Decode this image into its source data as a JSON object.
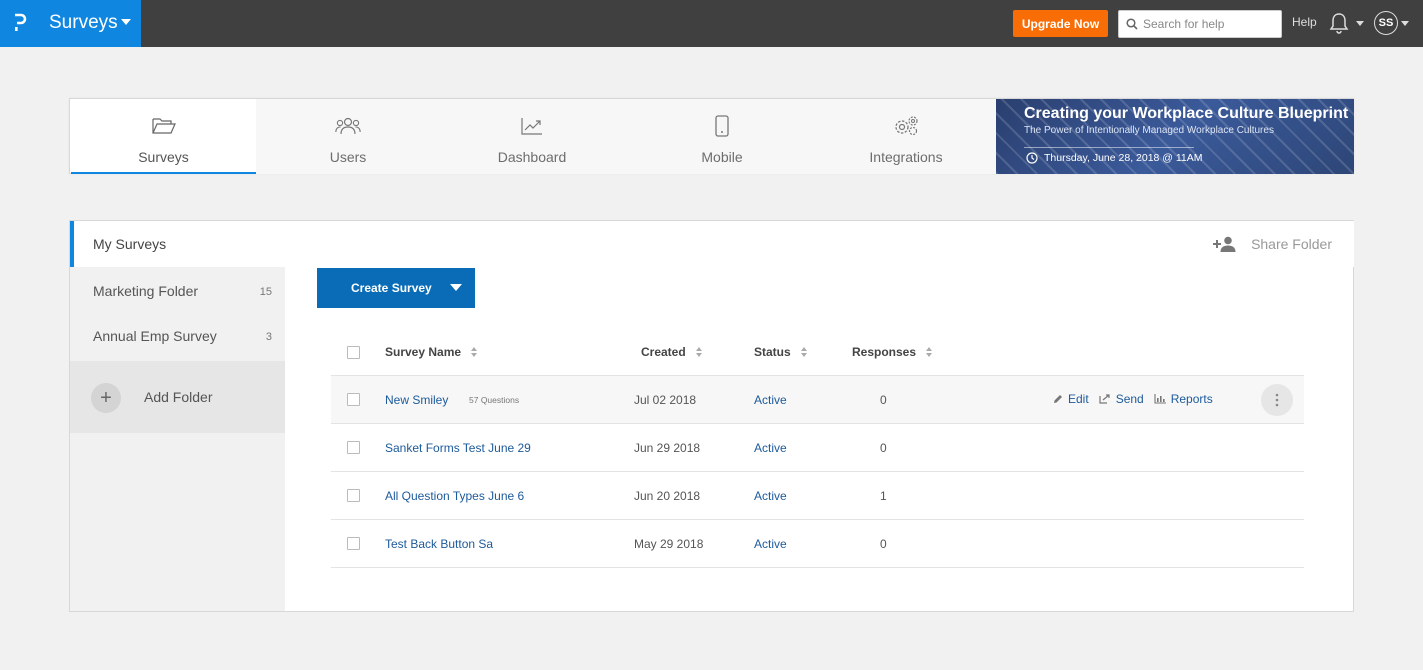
{
  "topbar": {
    "app_name": "Surveys",
    "upgrade_label": "Upgrade Now",
    "search_placeholder": "Search for help",
    "help_label": "Help",
    "avatar_initials": "SS"
  },
  "nav": {
    "tabs": [
      {
        "label": "Surveys",
        "icon": "folder-open-icon",
        "active": true
      },
      {
        "label": "Users",
        "icon": "users-icon",
        "active": false
      },
      {
        "label": "Dashboard",
        "icon": "chart-line-icon",
        "active": false
      },
      {
        "label": "Mobile",
        "icon": "mobile-icon",
        "active": false
      },
      {
        "label": "Integrations",
        "icon": "gears-icon",
        "active": false
      }
    ],
    "banner": {
      "title": "Creating your Workplace Culture Blueprint",
      "subtitle": "The Power of Intentionally Managed Workplace Cultures",
      "date": "Thursday, June 28, 2018 @ 11AM"
    }
  },
  "sidebar": {
    "header": "My Surveys",
    "folders": [
      {
        "name": "Marketing Folder",
        "count": "15"
      },
      {
        "name": "Annual Emp Survey",
        "count": "3"
      }
    ],
    "add_folder_label": "Add Folder"
  },
  "toolbar": {
    "share_folder_label": "Share Folder",
    "create_survey_label": "Create Survey"
  },
  "table": {
    "columns": [
      "Survey Name",
      "Created",
      "Status",
      "Responses"
    ],
    "rows": [
      {
        "name": "New Smiley",
        "questions": "57 Questions",
        "created": "Jul 02 2018",
        "status": "Active",
        "responses": "0"
      },
      {
        "name": "Sanket Forms Test June 29",
        "questions": "",
        "created": "Jun 29 2018",
        "status": "Active",
        "responses": "0"
      },
      {
        "name": "All Question Types June 6",
        "questions": "",
        "created": "Jun 20 2018",
        "status": "Active",
        "responses": "1"
      },
      {
        "name": "Test Back Button Sa",
        "questions": "",
        "created": "May 29 2018",
        "status": "Active",
        "responses": "0"
      }
    ],
    "row_actions": {
      "edit": "Edit",
      "send": "Send",
      "reports": "Reports"
    }
  },
  "colors": {
    "brand_blue": "#0f86e0",
    "topbar_bg": "#404040",
    "upgrade_orange": "#f96d06",
    "primary_button": "#0a6cb6",
    "link_blue": "#1d5a9a"
  }
}
